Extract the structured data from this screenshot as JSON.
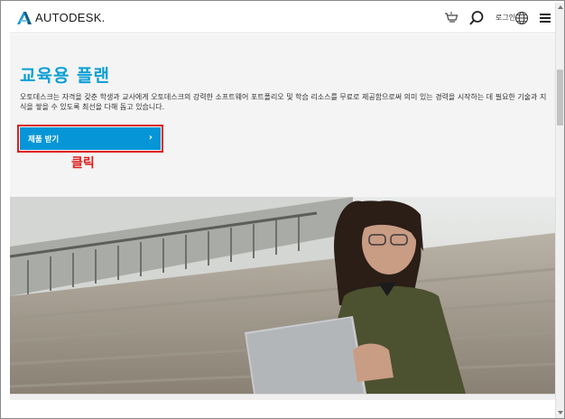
{
  "header": {
    "brand": "AUTODESK.",
    "login_label": "로그인"
  },
  "icons": {
    "logo": "autodesk-logo-icon",
    "cart": "cart-icon",
    "search": "search-icon",
    "globe": "globe-icon",
    "menu": "hamburger-menu-icon",
    "cta_arrow": "chevron-right-icon"
  },
  "main": {
    "title": "교육용 플랜",
    "description": "오토데스크는 자격을 갖춘 학생과 교사에게 오토데스크의 강력한 소프트웨어 포트폴리오 및 학습 리소스를 무료로 제공함으로써 의미 있는 경력을 시작하는 데 필요한 기술과 지식을 쌓을 수 있도록 최선을 다해 돕고 있습니다.",
    "cta_label": "제품 받기",
    "cta_arrow": "›",
    "annotation": "클릭"
  },
  "colors": {
    "accent": "#0696d7",
    "title": "#0a9fd6",
    "annotation": "#e01b1b"
  }
}
